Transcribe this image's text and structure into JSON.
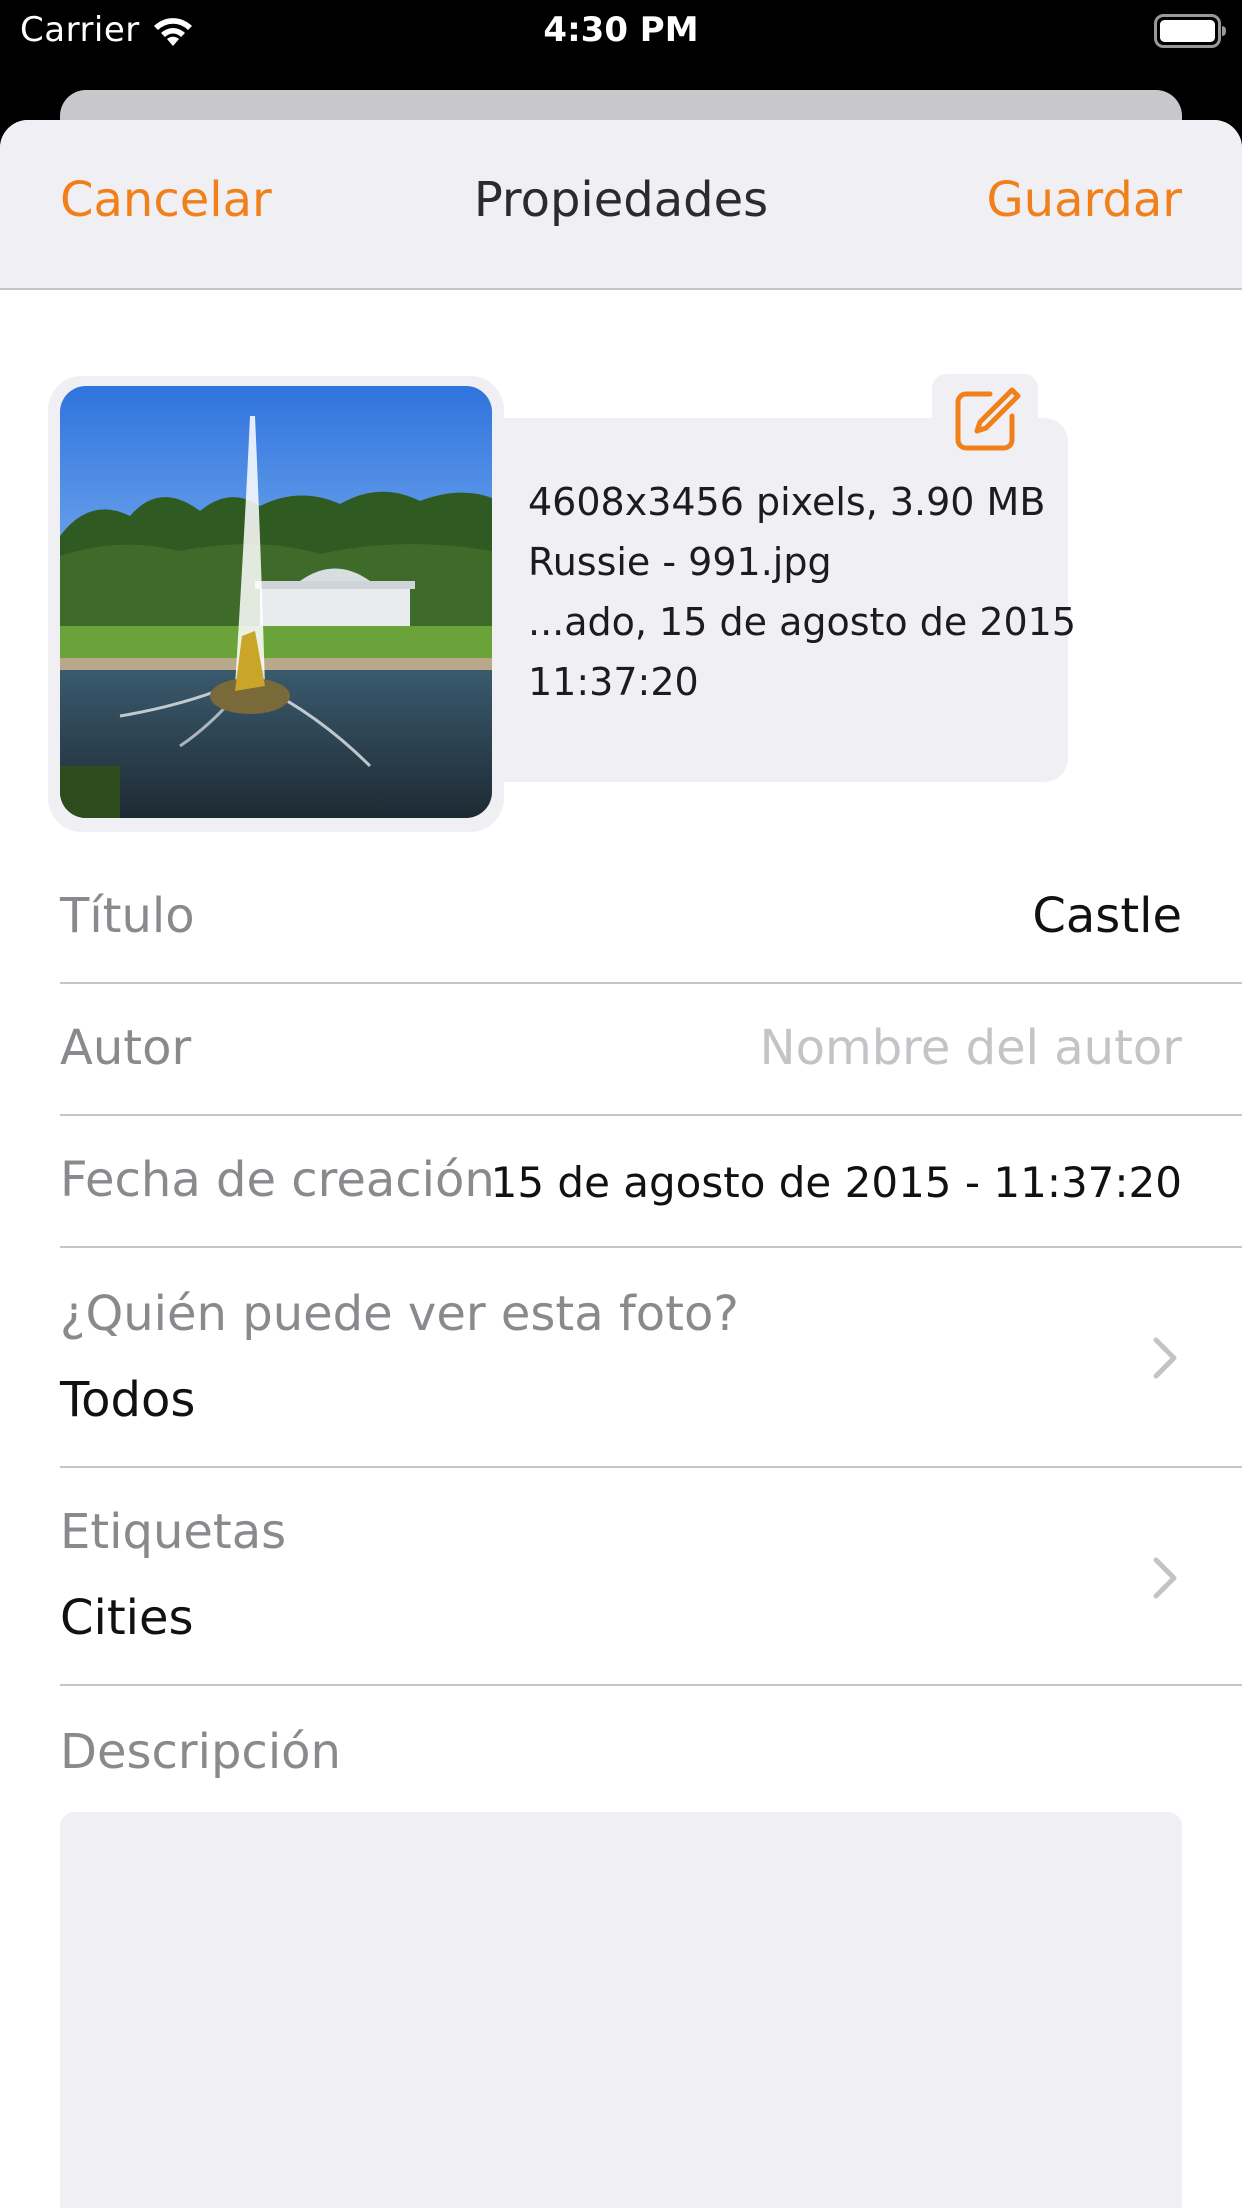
{
  "status_bar": {
    "carrier": "Carrier",
    "time": "4:30 PM"
  },
  "nav": {
    "cancel_label": "Cancelar",
    "title": "Propiedades",
    "save_label": "Guardar"
  },
  "photo_info": {
    "dimensions_size": "4608x3456 pixels, 3.90 MB",
    "filename": "Russie - 991.jpg",
    "date_line": "...ado, 15 de agosto de 2015",
    "time_line": "11:37:20"
  },
  "fields": {
    "title": {
      "label": "Título",
      "value": "Castle"
    },
    "author": {
      "label": "Autor",
      "placeholder": "Nombre del autor"
    },
    "created": {
      "label": "Fecha de creación",
      "value": "15 de agosto de 2015 - 11:37:20"
    },
    "visibility": {
      "label": "¿Quién puede ver esta foto?",
      "value": "Todos"
    },
    "tags": {
      "label": "Etiquetas",
      "value": "Cities"
    },
    "description": {
      "label": "Descripción",
      "value": ""
    }
  },
  "colors": {
    "accent": "#f2801a",
    "nav_background": "#efeff4",
    "label_gray": "#8a8a8e"
  },
  "icons": [
    "wifi-icon",
    "battery-icon",
    "edit-icon",
    "chevron-right-icon"
  ]
}
